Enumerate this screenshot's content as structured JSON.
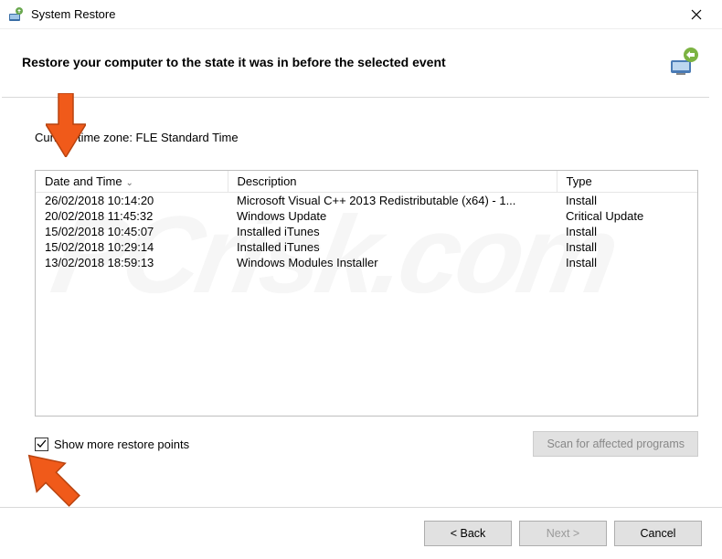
{
  "window": {
    "title": "System Restore",
    "heading": "Restore your computer to the state it was in before the selected event"
  },
  "timezone_label": "Current time zone: FLE Standard Time",
  "columns": {
    "date": "Date and Time",
    "desc": "Description",
    "type": "Type"
  },
  "rows": [
    {
      "date": "26/02/2018 10:14:20",
      "desc": "Microsoft Visual C++ 2013 Redistributable (x64) - 1...",
      "type": "Install"
    },
    {
      "date": "20/02/2018 11:45:32",
      "desc": "Windows Update",
      "type": "Critical Update"
    },
    {
      "date": "15/02/2018 10:45:07",
      "desc": "Installed iTunes",
      "type": "Install"
    },
    {
      "date": "15/02/2018 10:29:14",
      "desc": "Installed iTunes",
      "type": "Install"
    },
    {
      "date": "13/02/2018 18:59:13",
      "desc": "Windows Modules Installer",
      "type": "Install"
    }
  ],
  "checkbox_label": "Show more restore points",
  "scan_button": "Scan for affected programs",
  "buttons": {
    "back": "< Back",
    "next": "Next >",
    "cancel": "Cancel"
  },
  "watermark": "PCrisk.com"
}
